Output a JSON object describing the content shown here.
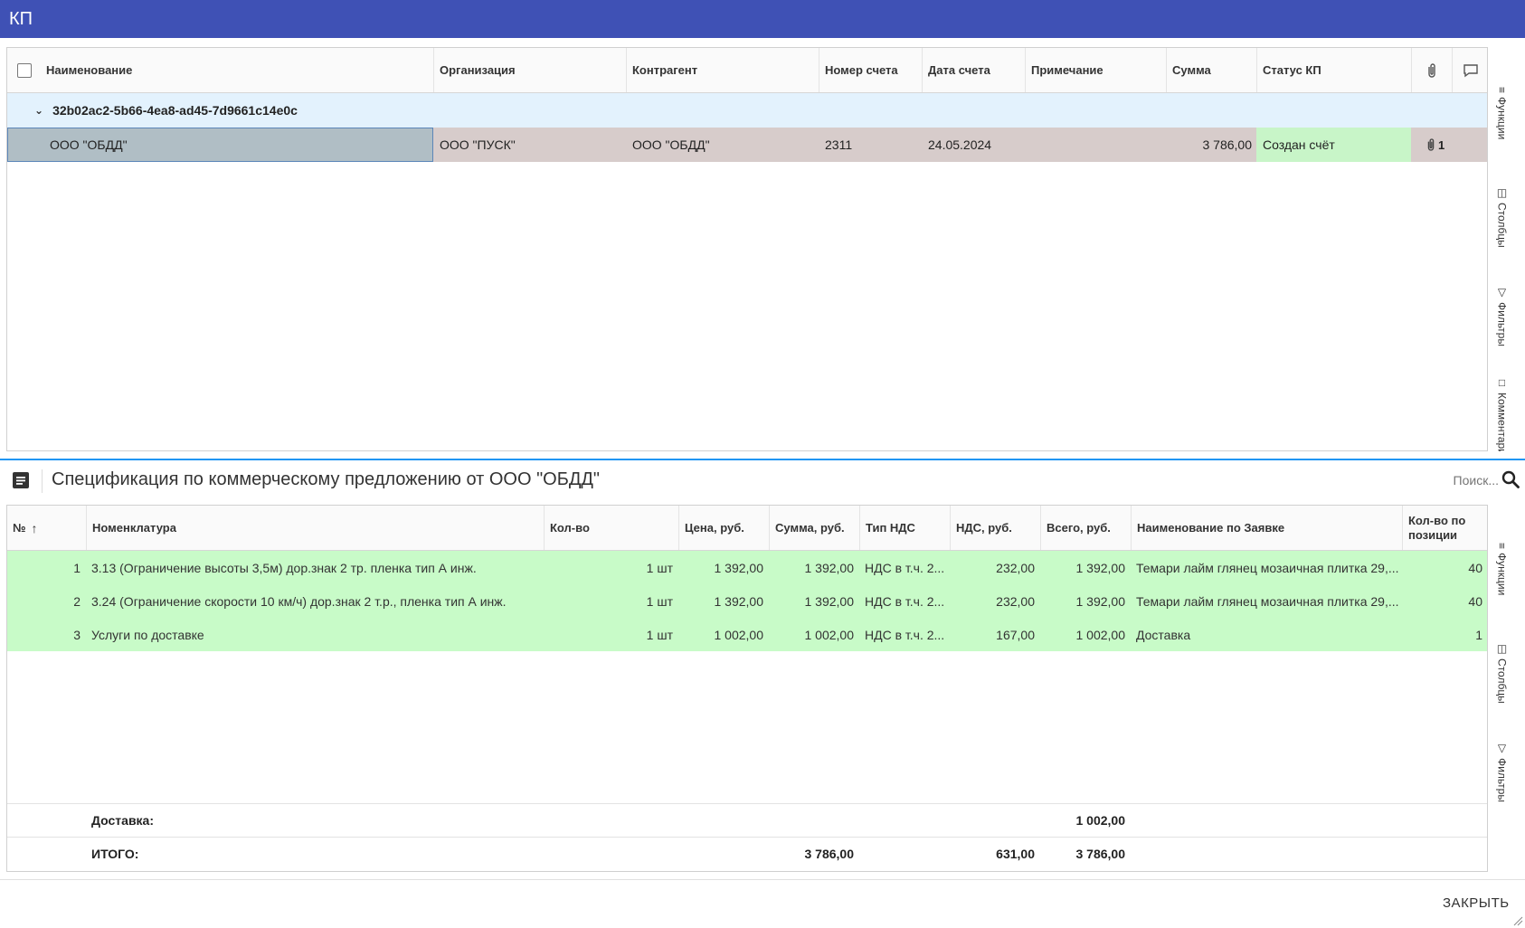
{
  "window": {
    "title": "КП"
  },
  "kp_table": {
    "columns": [
      "Наименование",
      "Организация",
      "Контрагент",
      "Номер счета",
      "Дата счета",
      "Примечание",
      "Сумма",
      "Статус КП"
    ],
    "group_label": "32b02ac2-5b66-4ea8-ad45-7d9661c14e0c",
    "row": {
      "name": "ООО \"ОБДД\"",
      "organization": "ООО \"ПУСК\"",
      "counterparty": "ООО \"ОБДД\"",
      "invoice_number": "2311",
      "invoice_date": "24.05.2024",
      "note": "",
      "sum": "3 786,00",
      "status": "Создан счёт",
      "attachments": "1"
    },
    "status_color": "#c8f5c8"
  },
  "side_panel_top": [
    "Функции",
    "Столбцы",
    "Фильтры",
    "Комментарии"
  ],
  "side_panel_bottom": [
    "Функции",
    "Столбцы",
    "Фильтры"
  ],
  "spec": {
    "title": "Спецификация по коммерческому предложению от ООО \"ОБДД\"",
    "search_placeholder": "Поиск...",
    "columns": {
      "num": "№",
      "nomenclature": "Номенклатура",
      "qty": "Кол-во",
      "price": "Цена, руб.",
      "sum": "Сумма, руб.",
      "vat_type": "Тип НДС",
      "vat": "НДС, руб.",
      "total": "Всего, руб.",
      "request_name": "Наименование по Заявке",
      "qty_pos_1": "Кол-во по",
      "qty_pos_2": "позиции"
    },
    "rows": [
      {
        "num": "1",
        "nomenclature": "3.13 (Ограничение высоты 3,5м) дор.знак 2 тр. пленка тип А инж.",
        "qty": "1 шт",
        "price": "1 392,00",
        "sum": "1 392,00",
        "vat_type": "НДС в т.ч. 2...",
        "vat": "232,00",
        "total": "1 392,00",
        "request_name": "Темари лайм глянец мозаичная плитка 29,...",
        "qty_pos": "40"
      },
      {
        "num": "2",
        "nomenclature": "3.24 (Ограничение скорости 10 км/ч) дор.знак 2 т.р., пленка тип А инж.",
        "qty": "1 шт",
        "price": "1 392,00",
        "sum": "1 392,00",
        "vat_type": "НДС в т.ч. 2...",
        "vat": "232,00",
        "total": "1 392,00",
        "request_name": "Темари лайм глянец мозаичная плитка 29,...",
        "qty_pos": "40"
      },
      {
        "num": "3",
        "nomenclature": "Услуги по доставке",
        "qty": "1 шт",
        "price": "1 002,00",
        "sum": "1 002,00",
        "vat_type": "НДС в т.ч. 2...",
        "vat": "167,00",
        "total": "1 002,00",
        "request_name": "Доставка",
        "qty_pos": "1"
      }
    ],
    "footer": {
      "delivery_label": "Доставка:",
      "delivery_total": "1 002,00",
      "total_label": "ИТОГО:",
      "total_sum": "3 786,00",
      "total_vat": "631,00",
      "total_total": "3 786,00"
    },
    "row_color": "#c8fbc8"
  },
  "actions": {
    "close": "ЗАКРЫТЬ"
  },
  "colors": {
    "titlebar": "#3f51b5",
    "divider": "#2196f3",
    "group_row": "#e3f2fd"
  }
}
